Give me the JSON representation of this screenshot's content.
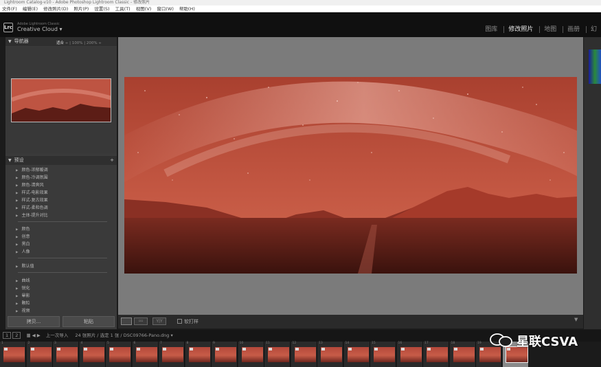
{
  "window": {
    "title": "Lightroom Catalog-v10 - Adobe Photoshop Lightroom Classic - 修改照片"
  },
  "menu": [
    "文件(F)",
    "编辑(E)",
    "修改照片(D)",
    "照片(P)",
    "设置(S)",
    "工具(T)",
    "视图(V)",
    "窗口(W)",
    "帮助(H)"
  ],
  "brand": {
    "logo": "Lrc",
    "small": "Adobe Lightroom Classic",
    "big": "Creative Cloud ▾"
  },
  "modules": [
    {
      "label": "图库"
    },
    {
      "label": "修改照片",
      "active": true
    },
    {
      "label": "地图"
    },
    {
      "label": "画册"
    },
    {
      "label": "幻"
    }
  ],
  "navigator": {
    "title": "导航器",
    "zoom_fit": "适合",
    "zoom_options": [
      "100%",
      "200%"
    ]
  },
  "presets": {
    "title": "预设",
    "group1": [
      "颜色-浓郁暖调",
      "颜色-冷调氛围",
      "颜色-清爽风",
      "样式-电影效果",
      "样式-复古效果",
      "样式-柔和色调",
      "主体-提升对比"
    ],
    "group2": [
      "颜色",
      "创意",
      "黑白",
      "人像"
    ],
    "group3": [
      "默认值"
    ],
    "group4": [
      "曲线",
      "锐化",
      "晕影",
      "颗粒",
      "视频"
    ]
  },
  "buttons": {
    "copy": "拷贝...",
    "paste": "粘贴"
  },
  "toolbar": {
    "ba": "▫▫",
    "yy": "Y|Y",
    "softproof": "软打样"
  },
  "filmbar": {
    "prev_import": "上一次导入",
    "count": "24 张照片 / 选定 1 张 /",
    "file": "DSC09766-Pano.dng ▾"
  },
  "filmstrip": {
    "frames": [
      "1",
      "2",
      "3",
      "4",
      "5",
      "6",
      "7",
      "8",
      "9",
      "10",
      "11",
      "12",
      "13",
      "14",
      "15",
      "16",
      "17",
      "18",
      "19",
      "20"
    ],
    "selected": 19
  },
  "watermark": "星联CSVA",
  "colors": {
    "photo_sky": "#b94d3c",
    "photo_ground": "#4a1a13",
    "mountain": "#a33a2a",
    "accent": "#e8e8e8"
  }
}
